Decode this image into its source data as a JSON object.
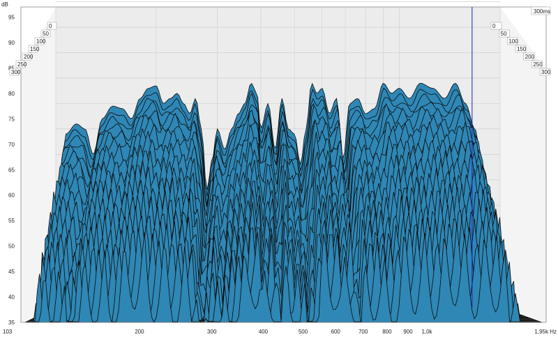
{
  "chart_data": {
    "type": "area",
    "subtype": "waterfall-3d",
    "title": "",
    "ylabel": "dB",
    "xlabel": "",
    "time_unit_label": "300ms",
    "ylim": [
      35,
      97
    ],
    "xlim": [
      103,
      1950
    ],
    "x_scale": "log",
    "grid": true,
    "y_ticks": [
      35,
      40,
      45,
      50,
      55,
      60,
      65,
      70,
      75,
      80,
      85,
      90,
      95
    ],
    "x_ticks": [
      {
        "value": 103,
        "label": "103"
      },
      {
        "value": 200,
        "label": "200"
      },
      {
        "value": 300,
        "label": "300"
      },
      {
        "value": 400,
        "label": "400"
      },
      {
        "value": 500,
        "label": "500"
      },
      {
        "value": 600,
        "label": "600"
      },
      {
        "value": 700,
        "label": "700"
      },
      {
        "value": 800,
        "label": "800"
      },
      {
        "value": 900,
        "label": "900"
      },
      {
        "value": 1000,
        "label": "1,0k"
      },
      {
        "value": 1950,
        "label": "1,95k Hz"
      }
    ],
    "time_slices_ms": [
      0,
      50,
      100,
      150,
      200,
      250,
      300
    ],
    "time_tick_labels": [
      "0",
      "50",
      "100",
      "150",
      "200",
      "250",
      "300"
    ],
    "cursor_frequency_hz": 1620,
    "front_response": {
      "frequency_hz": [
        103,
        110,
        118,
        125,
        132,
        140,
        150,
        160,
        170,
        180,
        190,
        200,
        210,
        220,
        230,
        240,
        250,
        260,
        270,
        280,
        290,
        300,
        315,
        330,
        345,
        360,
        375,
        390,
        400,
        420,
        440,
        460,
        480,
        500,
        520,
        540,
        560,
        580,
        600,
        630,
        660,
        690,
        720,
        760,
        800,
        850,
        900,
        950,
        1000,
        1070,
        1150,
        1250,
        1350,
        1450,
        1550,
        1650,
        1750,
        1850,
        1950
      ],
      "db": [
        36,
        69,
        71,
        70,
        65,
        72,
        74.5,
        74,
        72,
        76,
        78,
        78.5,
        75,
        76,
        77,
        75,
        73,
        76,
        70,
        58,
        64,
        70,
        66,
        70,
        73,
        75,
        79,
        77,
        70,
        75,
        66,
        76,
        70,
        69,
        63,
        70,
        79,
        77,
        78,
        73,
        76,
        64,
        75,
        76,
        73,
        74,
        79,
        77,
        78,
        76,
        79,
        78,
        76,
        79,
        75,
        70,
        60,
        45,
        36
      ]
    },
    "decay_db_per_slice": 1.4,
    "slice_count": 30,
    "fill_color": "#2f87b5",
    "edge_color": "#0b0b0b",
    "cursor_color": "#1c1cc8",
    "back_wall_color": "#ececec"
  }
}
